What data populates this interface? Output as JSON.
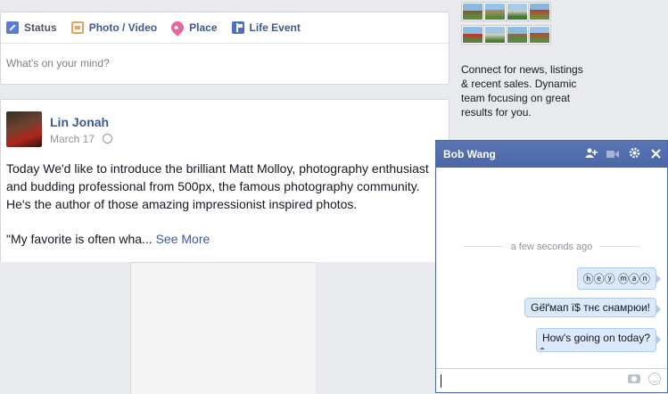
{
  "composer": {
    "tabs": [
      {
        "label": "Status",
        "icon": "pencil-icon",
        "active": true
      },
      {
        "label": "Photo / Video",
        "icon": "photo-icon"
      },
      {
        "label": "Place",
        "icon": "location-pin-icon"
      },
      {
        "label": "Life Event",
        "icon": "flag-icon"
      }
    ],
    "placeholder": "What's on your mind?"
  },
  "post": {
    "author": "Lin Jonah",
    "date": "March 17",
    "text_lines": [
      "Today We'd like to introduce the brilliant Matt Molloy, photography enthusiast",
      "and budding professional from 500px, the famous photography community.",
      "He's the author of those amazing impressionist inspired photos."
    ],
    "excerpt": "\"My favorite is often wha...",
    "see_more": "See More"
  },
  "ad": {
    "text": "Connect for news, listings & recent sales. Dynamic team focusing on great results for you."
  },
  "chat": {
    "name": "Bob Wang",
    "timestamp": "a few seconds ago",
    "messages": [
      "ⓗⓔⓨ ⓜⓐⓝ",
      "Gё̈ґмап ї$ тнє снамрюи!",
      "How's going on today?"
    ],
    "zalgo_tail": "̤̱̲̳̤̱̲̳̤̱̲̳̤̱̲̳̤̱̲̳̤̱̲̳"
  },
  "colors": {
    "brand_blue": "#3b5998",
    "chat_header": "#4e69a2",
    "bubble": "#daeafb"
  }
}
